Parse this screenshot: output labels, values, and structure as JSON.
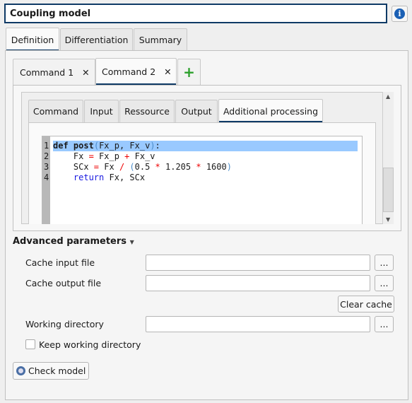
{
  "title": "Coupling model",
  "main_tabs": [
    {
      "label": "Definition",
      "active": true
    },
    {
      "label": "Differentiation"
    },
    {
      "label": "Summary"
    }
  ],
  "command_tabs": [
    {
      "label": "Command 1"
    },
    {
      "label": "Command 2",
      "active": true
    }
  ],
  "inner_tabs": [
    {
      "label": "Command"
    },
    {
      "label": "Input"
    },
    {
      "label": "Ressource"
    },
    {
      "label": "Output"
    },
    {
      "label": "Additional processing",
      "active": true
    }
  ],
  "code": {
    "line_numbers": [
      "1",
      "2",
      "3",
      "4"
    ],
    "lines": [
      [
        {
          "t": "def",
          "k": "kw"
        },
        {
          "t": " "
        },
        {
          "t": "post",
          "k": "kw"
        },
        {
          "t": "(",
          "k": "par"
        },
        {
          "t": "Fx_p, Fx_v"
        },
        {
          "t": ")",
          "k": "par"
        },
        {
          "t": ":"
        }
      ],
      [
        {
          "t": "    Fx "
        },
        {
          "t": "=",
          "k": "op"
        },
        {
          "t": " Fx_p "
        },
        {
          "t": "+",
          "k": "op"
        },
        {
          "t": " Fx_v"
        }
      ],
      [
        {
          "t": "    SCx "
        },
        {
          "t": "=",
          "k": "op"
        },
        {
          "t": " Fx "
        },
        {
          "t": "/",
          "k": "op"
        },
        {
          "t": " "
        },
        {
          "t": "(",
          "k": "par"
        },
        {
          "t": "0.5 "
        },
        {
          "t": "*",
          "k": "op"
        },
        {
          "t": " 1.205 "
        },
        {
          "t": "*",
          "k": "op"
        },
        {
          "t": " 1600"
        },
        {
          "t": ")",
          "k": "par"
        }
      ],
      [
        {
          "t": "    "
        },
        {
          "t": "return",
          "k": "ret"
        },
        {
          "t": " Fx, SCx"
        }
      ]
    ]
  },
  "advanced": {
    "label": "Advanced parameters",
    "cache_input_label": "Cache input file",
    "cache_input_value": "",
    "cache_output_label": "Cache output file",
    "cache_output_value": "",
    "browse": "...",
    "clear_cache": "Clear cache",
    "working_dir_label": "Working directory",
    "working_dir_value": "",
    "keep_wd_label": "Keep working directory",
    "keep_wd_checked": false
  },
  "check_model": "Check model"
}
